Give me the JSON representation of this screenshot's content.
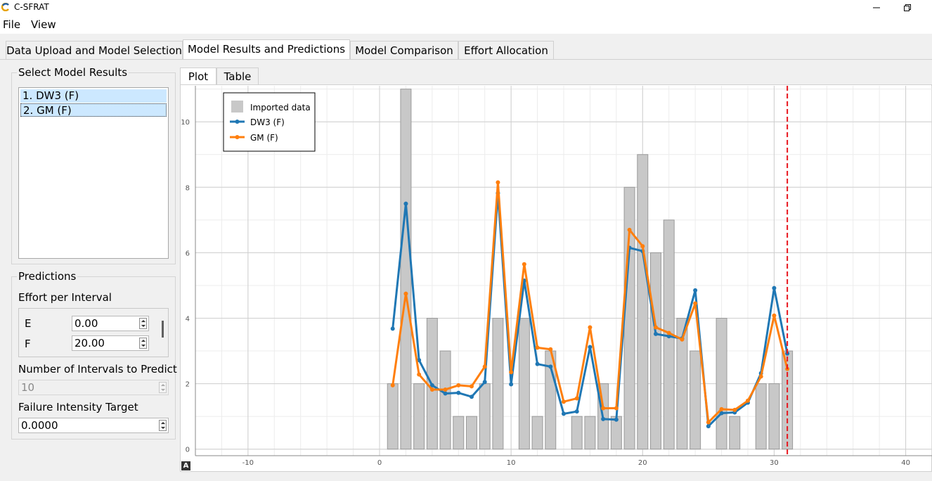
{
  "window": {
    "title": "C-SFRAT"
  },
  "menu": {
    "file": "File",
    "view": "View"
  },
  "tabs": {
    "t1": "Data Upload and Model Selection",
    "t2": "Model Results and Predictions",
    "t3": "Model Comparison",
    "t4": "Effort Allocation"
  },
  "left": {
    "select_title": "Select Model Results",
    "models": [
      "1. DW3 (F)",
      "2. GM (F)"
    ],
    "pred_title": "Predictions",
    "effort_label": "Effort per Interval",
    "e_label": "E",
    "e_value": "0.00",
    "f_label": "F",
    "f_value": "20.00",
    "n_label": "Number of Intervals to Predict",
    "n_value": "10",
    "fit_label": "Failure Intensity Target",
    "fit_value": "0.0000"
  },
  "subtabs": {
    "plot": "Plot",
    "table": "Table"
  },
  "autoscale_label": "A",
  "colors": {
    "imported": "#c8c8c8",
    "dw3": "#1f77b4",
    "gm": "#ff7f0e",
    "cutoff": "#e8141c"
  },
  "chart_data": {
    "type": "bar",
    "xlim": [
      -14,
      42
    ],
    "ylim": [
      -0.2,
      11.1
    ],
    "xticks": [
      -10,
      0,
      10,
      20,
      30,
      40
    ],
    "yticks": [
      0,
      2,
      4,
      6,
      8,
      10
    ],
    "grid": true,
    "legend": "top-left",
    "cutoff_x": 31,
    "x": [
      1,
      2,
      3,
      4,
      5,
      6,
      7,
      8,
      9,
      10,
      11,
      12,
      13,
      14,
      15,
      16,
      17,
      18,
      19,
      20,
      21,
      22,
      23,
      24,
      25,
      26,
      27,
      28,
      29,
      30,
      31
    ],
    "series": [
      {
        "name": "Imported data",
        "kind": "bar",
        "values": [
          2,
          11,
          2,
          4,
          3,
          1,
          1,
          2,
          4,
          0,
          4,
          1,
          3,
          0,
          1,
          1,
          2,
          1,
          8,
          9,
          6,
          7,
          4,
          3,
          0,
          4,
          1,
          0,
          2,
          2,
          3
        ]
      },
      {
        "name": "DW3 (F)",
        "kind": "line",
        "values": [
          3.68,
          7.5,
          2.72,
          1.95,
          1.7,
          1.72,
          1.6,
          2.05,
          7.82,
          1.98,
          5.15,
          2.6,
          2.52,
          1.08,
          1.15,
          3.12,
          0.92,
          0.9,
          6.15,
          6.05,
          3.52,
          3.45,
          3.38,
          4.85,
          0.7,
          1.1,
          1.12,
          1.42,
          2.32,
          4.92,
          2.92
        ]
      },
      {
        "name": "GM (F)",
        "kind": "line",
        "values": [
          1.95,
          4.75,
          2.28,
          1.82,
          1.82,
          1.95,
          1.92,
          2.52,
          8.15,
          2.35,
          5.65,
          3.1,
          3.05,
          1.45,
          1.55,
          3.72,
          1.25,
          1.25,
          6.7,
          6.2,
          3.72,
          3.55,
          3.35,
          4.45,
          0.82,
          1.22,
          1.2,
          1.48,
          2.22,
          4.08,
          2.45
        ]
      }
    ]
  }
}
